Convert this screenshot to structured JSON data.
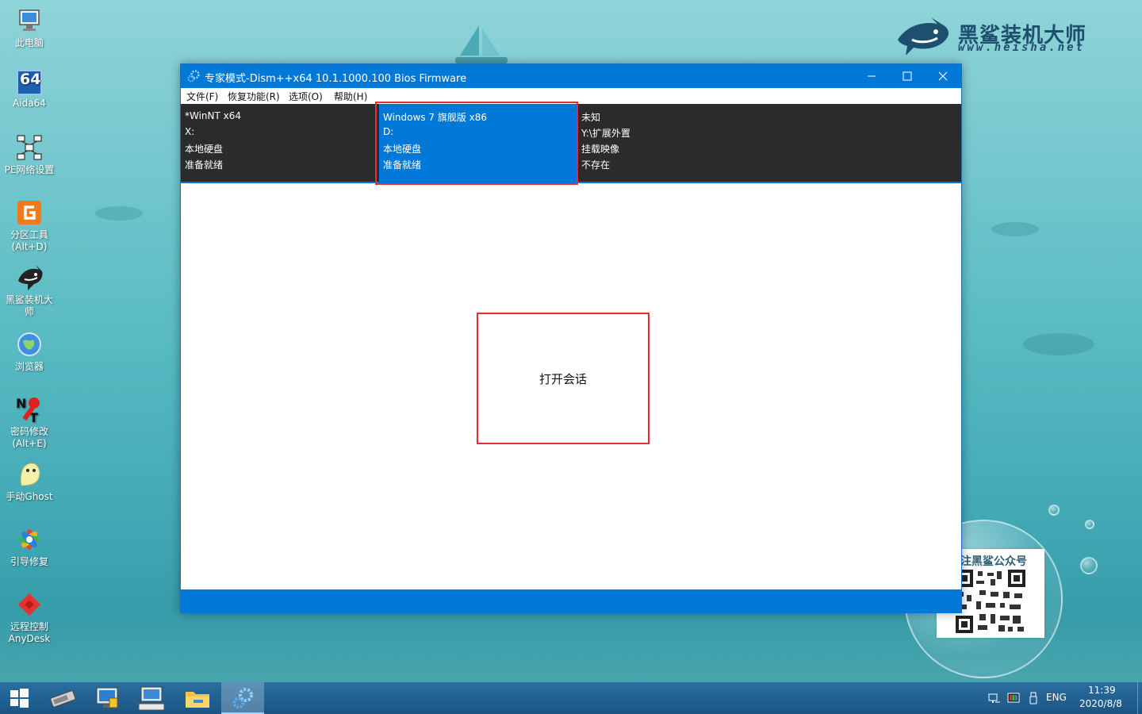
{
  "desktop": {
    "icons": [
      {
        "label": "此电脑",
        "icon": "computer-icon"
      },
      {
        "label": "Aida64",
        "icon": "aida64-icon"
      },
      {
        "label": "PE网络设置",
        "icon": "network-icon"
      },
      {
        "label": "分区工具",
        "label2": "(Alt+D)",
        "icon": "partition-tool-icon"
      },
      {
        "label": "黑鲨装机大",
        "label2": "师",
        "icon": "shark-installer-icon"
      },
      {
        "label": "浏览器",
        "icon": "browser-icon"
      },
      {
        "label": "密码修改",
        "label2": "(Alt+E)",
        "icon": "password-reset-icon"
      },
      {
        "label": "手动Ghost",
        "icon": "ghost-icon"
      },
      {
        "label": "引导修复",
        "icon": "boot-repair-icon"
      },
      {
        "label": "远程控制",
        "label2": "AnyDesk",
        "icon": "anydesk-icon"
      }
    ],
    "aida_badge": "64",
    "brand": {
      "name": "黑鲨装机大师",
      "url": "www.heisha.net"
    },
    "qr_title": "注黑鲨公众号"
  },
  "window": {
    "title": "专家模式-Dism++x64 10.1.1000.100 Bios Firmware",
    "menu": [
      "文件(F)",
      "恢复功能(R)",
      "选项(O)",
      "帮助(H)"
    ],
    "drives": [
      {
        "name": "*WinNT x64",
        "letter": "X:",
        "type": "本地硬盘",
        "status": "准备就绪",
        "selected": false
      },
      {
        "name": "Windows 7 旗舰版 x86",
        "letter": "D:",
        "type": "本地硬盘",
        "status": "准备就绪",
        "selected": true
      },
      {
        "name": "未知",
        "letter": "Y:\\扩展外置",
        "type": "挂载映像",
        "status": "不存在",
        "selected": false
      }
    ],
    "open_session_label": "打开会话"
  },
  "colors": {
    "accent": "#0078d7",
    "highlight_box": "#e53030",
    "drive_bar": "#2b2b2b"
  },
  "taskbar": {
    "apps": [
      "start-icon",
      "drive-tool-icon",
      "computer-config-icon",
      "keyboard-icon",
      "file-explorer-icon",
      "dism-gear-icon"
    ],
    "tray": {
      "lang": "ENG",
      "time": "11:39",
      "date": "2020/8/8"
    }
  }
}
